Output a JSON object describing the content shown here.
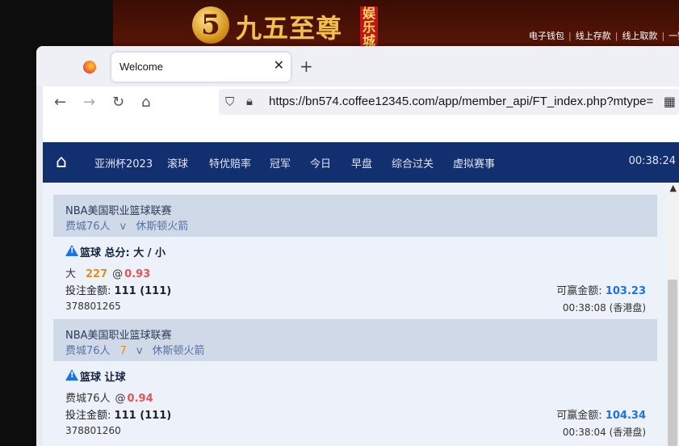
{
  "site": {
    "logo_glyph": "5",
    "logo_text": "九五至尊",
    "logo_tag": "娱乐城",
    "links": [
      "电子钱包",
      "线上存款",
      "线上取款",
      "一键"
    ]
  },
  "browser": {
    "tab_title": "Welcome",
    "url": "https://bn574.coffee12345.com/app/member_api/FT_index.php?mtype="
  },
  "topnav": {
    "items": [
      "亚洲杯2023",
      "滚球",
      "特优赔率",
      "冠军",
      "今日",
      "早盘",
      "综合过关",
      "虚拟赛事"
    ],
    "clock": "00:38:24"
  },
  "bets": [
    {
      "league": "NBA美国职业篮球联赛",
      "home": "费城76人",
      "handicap": "",
      "vs": "v",
      "away": "休斯顿火箭",
      "bet_type": "篮球 总分: 大 / 小",
      "pick_label": "大",
      "pick_line": "227",
      "at": "@",
      "odds": "0.93",
      "stake_label": "投注金额:",
      "stake_value": "111 (111)",
      "win_label": "可赢金额:",
      "win_value": "103.23",
      "ticket_id": "378801265",
      "time": "00:38:08 (香港盘)"
    },
    {
      "league": "NBA美国职业篮球联赛",
      "home": "费城76人",
      "handicap": "7",
      "vs": "v",
      "away": "休斯顿火箭",
      "bet_type": "篮球 让球",
      "pick_label": "费城76人",
      "pick_line": "",
      "at": "@",
      "odds": "0.94",
      "stake_label": "投注金额:",
      "stake_value": "111 (111)",
      "win_label": "可赢金额:",
      "win_value": "104.34",
      "ticket_id": "378801260",
      "time": "00:38:04 (香港盘)"
    }
  ],
  "colors": {
    "nav_bg": "#12306f",
    "accent_blue": "#1a73e8",
    "odds_red": "#e05555",
    "line_orange": "#e58e1a"
  }
}
